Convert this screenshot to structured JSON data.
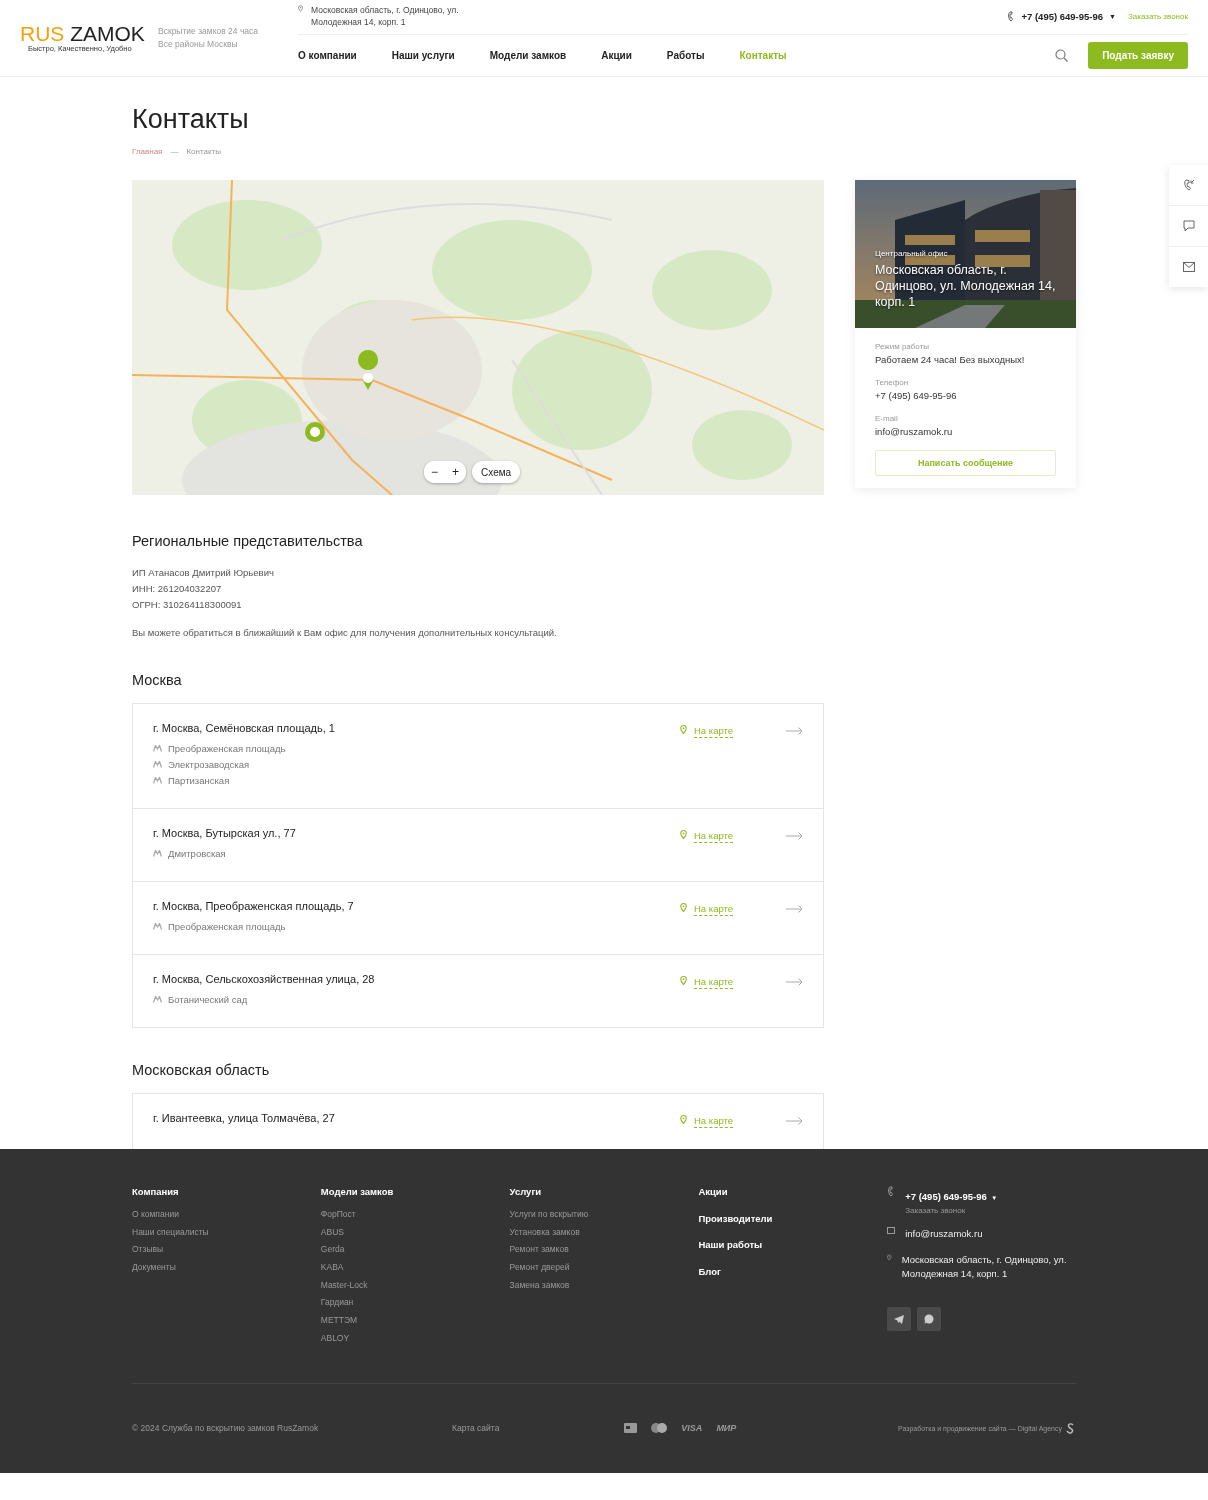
{
  "header": {
    "logo_accent": "RUS",
    "logo_main": "ZAMOK",
    "logo_tagline": "Быстро, Качественно, Удобно",
    "slogan": [
      "Вскрытие замков 24 часа",
      "Все районы Москвы"
    ],
    "address": "Московская область, г. Одинцово, ул. Молодежная 14, корп. 1",
    "phone": "+7 (495) 649-95-96",
    "phone_caret": "▼",
    "callback": "Заказать звонок",
    "nav": [
      {
        "label": "О компании",
        "selected": false
      },
      {
        "label": "Наши услуги",
        "selected": false
      },
      {
        "label": "Модели замков",
        "selected": false
      },
      {
        "label": "Акции",
        "selected": false
      },
      {
        "label": "Работы",
        "selected": false
      },
      {
        "label": "Контакты",
        "selected": true
      }
    ],
    "cta": "Подать заявку"
  },
  "page": {
    "title": "Контакты",
    "breadcrumbs": [
      "Главная",
      "Контакты"
    ],
    "breadcrumb_separator": "—"
  },
  "map": {
    "kind": "picture",
    "zoom_out": "−",
    "zoom_in": "+",
    "layer_button": "Схема"
  },
  "office": {
    "photo_caption": "Центральный офис",
    "photo_address": "Московская область, г. Одинцово, ул. Молодежная 14, корп. 1",
    "fields": [
      {
        "label": "Режим работы",
        "value": "Работаем 24 часа! Без выходных!"
      },
      {
        "label": "Телефон",
        "value": "+7 (495) 649-95-96"
      },
      {
        "label": "E-mail",
        "value": "info@ruszamok.ru"
      }
    ],
    "button": "Написать сообщение"
  },
  "regional": {
    "title": "Региональные представительства",
    "details": [
      "ИП Атанасов Дмитрий Юрьевич",
      "ИНН: 261204032207",
      "ОГРН: 310264118300091"
    ],
    "note": "Вы можете обратиться в ближайший к Вам офис для получения дополнительных консультаций."
  },
  "regions": [
    {
      "name": "Москва",
      "offices": [
        {
          "address": "г. Москва, Семёновская площадь, 1",
          "metro": [
            "Преображенская площадь",
            "Электрозаводская",
            "Партизанская"
          ],
          "map_link": "На карте"
        },
        {
          "address": "г. Москва, Бутырская ул., 77",
          "metro": [
            "Дмитровская"
          ],
          "map_link": "На карте"
        },
        {
          "address": "г. Москва, Преображенская площадь, 7",
          "metro": [
            "Преображенская площадь"
          ],
          "map_link": "На карте"
        },
        {
          "address": "г. Москва, Сельскохозяйственная улица, 28",
          "metro": [
            "Ботанический сад"
          ],
          "map_link": "На карте"
        }
      ]
    },
    {
      "name": "Московская область",
      "offices": [
        {
          "address": "г. Ивантеевка, улица Толмачёва, 27",
          "map_link": "На карте"
        }
      ]
    }
  ],
  "footer": {
    "columns": [
      {
        "title": "Компания",
        "links": [
          "О компании",
          "Наши специалисты",
          "Отзывы",
          "Документы"
        ]
      },
      {
        "title": "Модели замков",
        "links": [
          "ФорПост",
          "ABUS",
          "Gerda",
          "KABA",
          "Master-Lock",
          "Гардиан",
          "МЕТТЭМ",
          "ABLOY"
        ]
      },
      {
        "title": "Услуги",
        "links": [
          "Услуги по вскрытию",
          "Установка замков",
          "Ремонт замков",
          "Ремонт дверей",
          "Замена замков"
        ]
      }
    ],
    "sections": [
      "Акции",
      "Производители",
      "Наши работы",
      "Блог"
    ],
    "phone": "+7 (495) 649-95-96",
    "phone_caret": "▼",
    "callback": "Заказать звонок",
    "email": "info@ruszamok.ru",
    "address": "Московская область, г. Одинцово, ул. Молодежная 14, корп. 1",
    "copyright": "© 2024 Служба по вскрытию замков RusZamok",
    "sitemap": "Карта сайта",
    "payments": [
      "VISA",
      "МИР"
    ],
    "developer": "Разработка и продвижение сайта — Digital Agency"
  }
}
